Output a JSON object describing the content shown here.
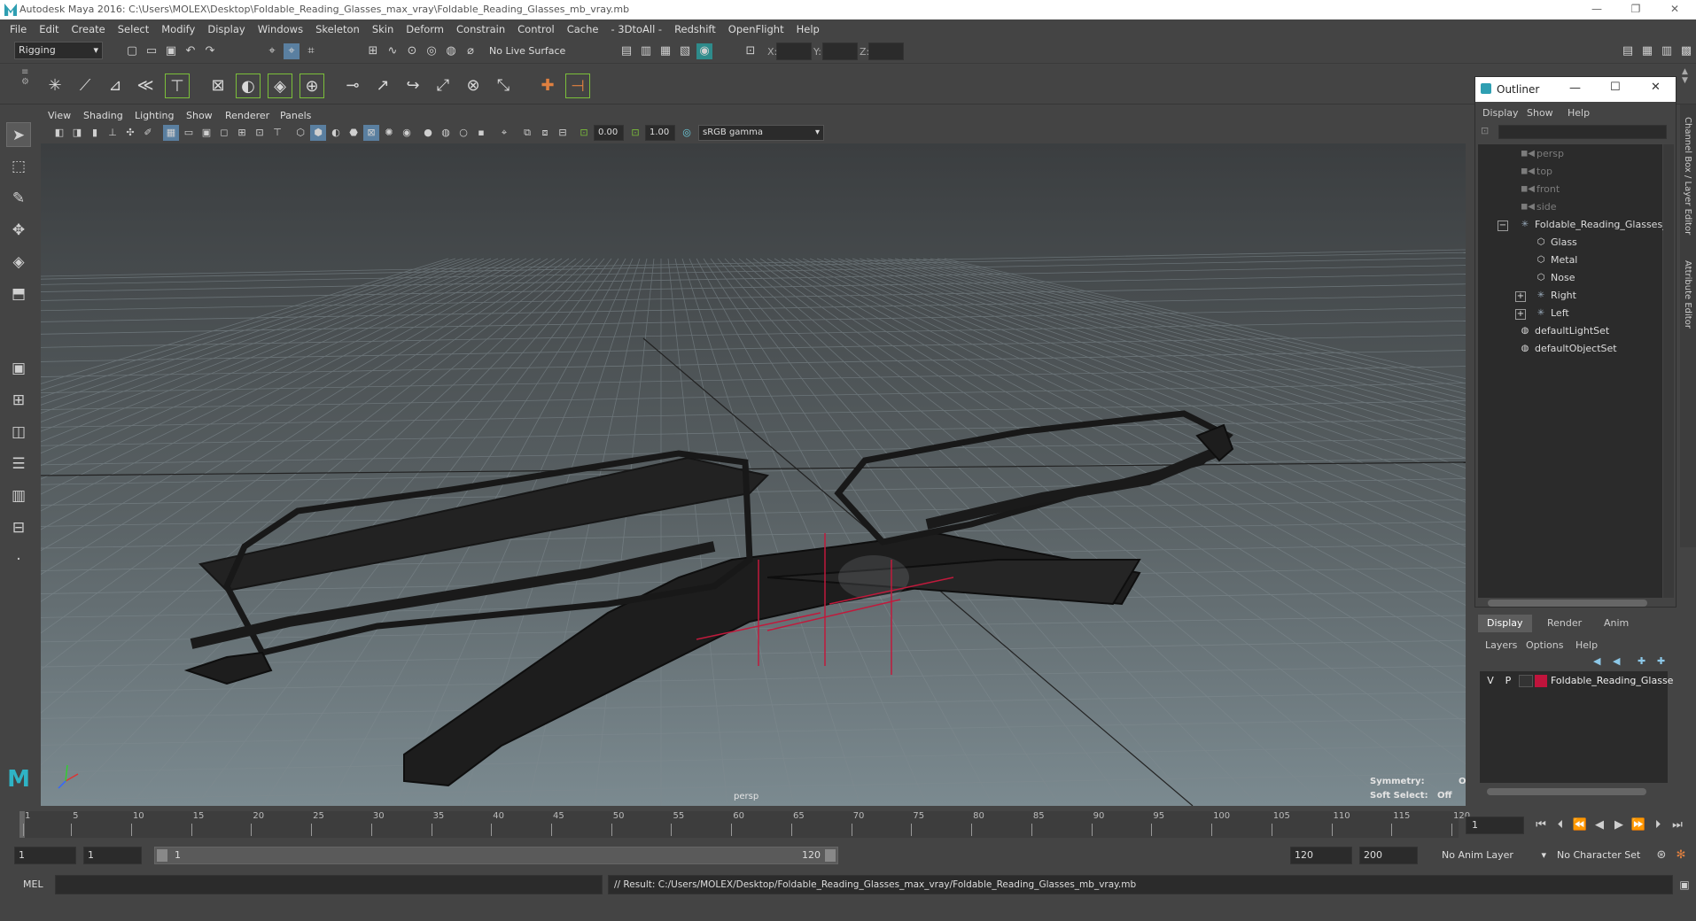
{
  "window": {
    "title": "Autodesk Maya 2016: C:\\Users\\MOLEX\\Desktop\\Foldable_Reading_Glasses_max_vray\\Foldable_Reading_Glasses_mb_vray.mb",
    "minimize_icon": "minimize-icon",
    "restore_icon": "restore-icon",
    "close_icon": "close-icon"
  },
  "menubar": [
    "File",
    "Edit",
    "Create",
    "Select",
    "Modify",
    "Display",
    "Windows",
    "Skeleton",
    "Skin",
    "Deform",
    "Constrain",
    "Control",
    "Cache",
    "- 3DtoAll -",
    "Redshift",
    "OpenFlight",
    "Help"
  ],
  "statusline": {
    "menuset": "Rigging",
    "live_surface": "No Live Surface",
    "x_label": "X:",
    "y_label": "Y:",
    "z_label": "Z:"
  },
  "panel": {
    "menus": [
      "View",
      "Shading",
      "Lighting",
      "Show",
      "Renderer",
      "Panels"
    ],
    "exposure": "0.00",
    "gamma": "1.00",
    "colorspace": "sRGB gamma"
  },
  "viewport": {
    "camera": "persp",
    "symmetry_label": "Symmetry:",
    "symmetry_value": "Off",
    "soft_select_label": "Soft Select:",
    "soft_select_value": "Off"
  },
  "outliner": {
    "title": "Outliner",
    "menus": [
      "Display",
      "Show",
      "Help"
    ],
    "items": [
      {
        "label": "persp",
        "icon": "camera-icon",
        "dim": true
      },
      {
        "label": "top",
        "icon": "camera-icon",
        "dim": true
      },
      {
        "label": "front",
        "icon": "camera-icon",
        "dim": true
      },
      {
        "label": "side",
        "icon": "camera-icon",
        "dim": true
      },
      {
        "label": "Foldable_Reading_Glasses_n",
        "icon": "group-icon",
        "dim": false
      },
      {
        "label": "Glass",
        "icon": "mesh-icon",
        "dim": false
      },
      {
        "label": "Metal",
        "icon": "mesh-icon",
        "dim": false
      },
      {
        "label": "Nose",
        "icon": "mesh-icon",
        "dim": false
      },
      {
        "label": "Right",
        "icon": "group-icon",
        "dim": false
      },
      {
        "label": "Left",
        "icon": "group-icon",
        "dim": false
      },
      {
        "label": "defaultLightSet",
        "icon": "set-icon",
        "dim": false
      },
      {
        "label": "defaultObjectSet",
        "icon": "set-icon",
        "dim": false
      }
    ]
  },
  "layers": {
    "tabs": [
      "Display",
      "Render",
      "Anim"
    ],
    "menus": [
      "Layers",
      "Options",
      "Help"
    ],
    "layer": {
      "v": "V",
      "p": "P",
      "name": "Foldable_Reading_Glasse",
      "color": "#c0143c"
    }
  },
  "sidetabs": [
    "Channel Box / Layer Editor",
    "Attribute Editor"
  ],
  "timeslider": {
    "ticks": [
      "1",
      "5",
      "10",
      "15",
      "20",
      "25",
      "30",
      "35",
      "40",
      "45",
      "50",
      "55",
      "60",
      "65",
      "70",
      "75",
      "80",
      "85",
      "90",
      "95",
      "100",
      "105",
      "110",
      "115",
      "120"
    ],
    "current_frame": "1"
  },
  "range": {
    "start_outer": "1",
    "start_inner": "1",
    "slider_start": "1",
    "slider_end": "120",
    "end_inner": "120",
    "end_outer": "200",
    "anim_layer": "No Anim Layer",
    "character_set": "No Character Set"
  },
  "cmdline": {
    "lang": "MEL",
    "result": "// Result: C:/Users/MOLEX/Desktop/Foldable_Reading_Glasses_max_vray/Foldable_Reading_Glasses_mb_vray.mb"
  },
  "colors": {
    "bg": "#444444",
    "field": "#2b2b2b",
    "accent": "#7bbf3a",
    "selected_tab": "#5d5d5d",
    "locator": "#c01a3c"
  }
}
